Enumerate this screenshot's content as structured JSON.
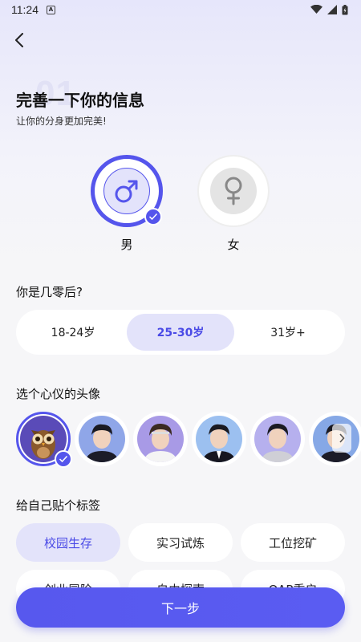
{
  "status_bar": {
    "time": "11:24",
    "notif_letter": "A"
  },
  "header": {
    "back_icon": "chevron-left-icon",
    "step_watermark": "01",
    "title": "完善一下你的信息",
    "subtitle": "让你的分身更加完美!"
  },
  "gender": {
    "male_label": "男",
    "female_label": "女",
    "selected": "male"
  },
  "age": {
    "title": "你是几零后?",
    "options": [
      "18-24岁",
      "25-30岁",
      "31岁+"
    ],
    "selected_index": 1
  },
  "avatar_section": {
    "title": "选个心仪的头像",
    "avatars": [
      "owl-avatar",
      "boy-avatar-1",
      "boy-avatar-2",
      "boy-avatar-3",
      "boy-avatar-4",
      "boy-avatar-5"
    ],
    "selected_index": 0
  },
  "tags_section": {
    "title": "给自己贴个标签",
    "tags": [
      "校园生存",
      "实习试炼",
      "工位挖矿",
      "创业冒险",
      "自由探索",
      "OAP重启"
    ],
    "selected_index": 0
  },
  "footer": {
    "next_label": "下一步"
  },
  "colors": {
    "accent": "#5555ec",
    "accent_light": "#e3e3fa"
  }
}
